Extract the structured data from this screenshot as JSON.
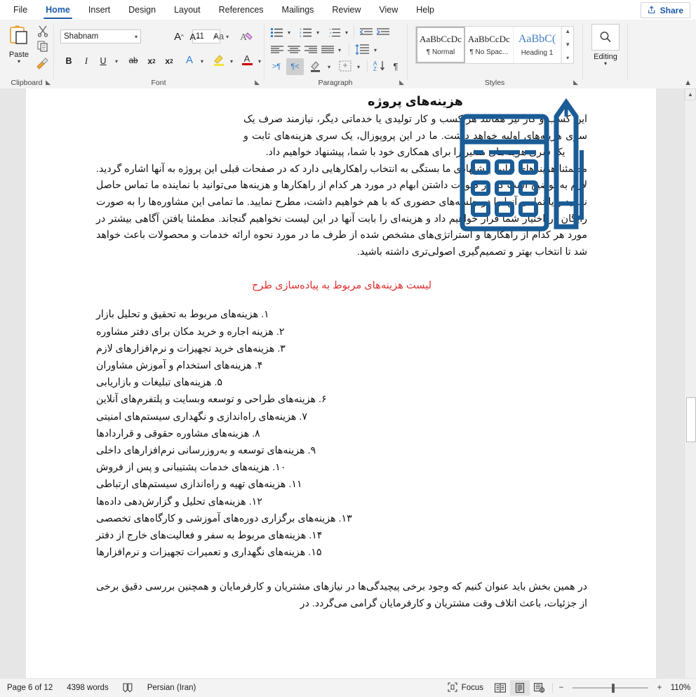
{
  "titlebar": {
    "share_label": "Share"
  },
  "tabs": [
    {
      "label": "File",
      "active": false
    },
    {
      "label": "Home",
      "active": true
    },
    {
      "label": "Insert",
      "active": false
    },
    {
      "label": "Design",
      "active": false
    },
    {
      "label": "Layout",
      "active": false
    },
    {
      "label": "References",
      "active": false
    },
    {
      "label": "Mailings",
      "active": false
    },
    {
      "label": "Review",
      "active": false
    },
    {
      "label": "View",
      "active": false
    },
    {
      "label": "Help",
      "active": false
    }
  ],
  "ribbon": {
    "clipboard": {
      "group_label": "Clipboard",
      "paste_label": "Paste",
      "cut_icon": "scissors-icon",
      "copy_icon": "copy-icon",
      "format_painter_icon": "paintbrush-icon",
      "dialog_launcher": "⤵"
    },
    "font": {
      "group_label": "Font",
      "font_name": "Shabnam",
      "font_size": "11",
      "grow_font": "A",
      "shrink_font": "A",
      "change_case": "Aa",
      "clear_formatting": "A",
      "bold": "B",
      "italic": "I",
      "underline": "U",
      "strikethrough": "ab",
      "subscript": "x",
      "superscript": "x",
      "text_effects": "A",
      "highlight": "A",
      "font_color": "A",
      "dialog_launcher": "⤵"
    },
    "paragraph": {
      "group_label": "Paragraph",
      "bullets": "bullets-icon",
      "numbering": "numbering-icon",
      "multilevel": "multilevel-list-icon",
      "decrease_indent": "decrease-indent-icon",
      "increase_indent": "increase-indent-icon",
      "align_left": "align-left-icon",
      "center": "align-center-icon",
      "align_right": "align-right-icon",
      "justify": "justify-icon",
      "line_spacing": "line-spacing-icon",
      "ltr": ">¶",
      "rtl": "¶<",
      "shading": "shading-icon",
      "borders": "borders-icon",
      "sort": "sort-icon",
      "show_marks": "¶",
      "dialog_launcher": "⤵"
    },
    "styles": {
      "group_label": "Styles",
      "items": [
        {
          "sample": "AaBbCcDc",
          "name": "¶ Normal",
          "selected": true
        },
        {
          "sample": "AaBbCcDc",
          "name": "¶ No Spac...",
          "selected": false
        },
        {
          "sample": "AaBbC(",
          "name": "Heading 1",
          "selected": false
        }
      ],
      "dialog_launcher": "⤵"
    },
    "editing": {
      "group_label": "",
      "label": "Editing",
      "icon": "magnifier-icon"
    },
    "collapse_icon": "chevron-up-icon"
  },
  "document": {
    "heading": "هزینه‌های پروژه",
    "paragraph1": "این کسب و کار نیز همانند هر کسب و کار تولیدی یا خدماتی دیگر، نیازمند صرف یک سری هزینه‌های اولیه خواهد داشت. ما در این پروپوزال، یک سری هزینه‌های ثابت و یک سری هزینه‌های متغیر را برای همکاری خود با شما، پیشنهاد خواهیم داد.",
    "paragraph2": "مطمئنا هزینه‌های نهایی پیشنهادی ما بستگی به انتخاب راهکارهایی دارد که در صفحات قبلی این پروژه به آنها اشاره گردید. لازم به توضیح است که در صورت داشتن ابهام در مورد هر کدام از راهکارها و هزینه‌ها می‌توانید با نماینده ما تماس حاصل نمایید و یا تمامی آنها را در جلسه‌های حضوری که با هم خواهیم داشت، مطرح نمایید. ما تمامی این مشاوره‌ها را به صورت رایگان در اختیار شما قرار خواهیم داد و هزینه‌ای را بابت آنها در این لیست نخواهیم گنجاند. مطمئنا یافتن آگاهی بیشتر در مورد هر کدام از راهکارها و استراتژی‌های مشخص شده از طرف ما در مورد نحوه ارائه خدمات و محصولات باعث خواهد شد تا انتخاب بهتر و تصمیم‌گیری اصولی‌تری داشته باشید.",
    "red_heading": "لیست هزینه‌های مربوط به پیاده‌سازی طرح",
    "red_heading_color": "#e03030",
    "list": [
      {
        "num": "۱.",
        "text": "هزینه‌های مربوط به تحقیق و تحلیل بازار"
      },
      {
        "num": "۲.",
        "text": "هزینه اجاره و خرید مکان برای دفتر مشاوره"
      },
      {
        "num": "۳.",
        "text": "هزینه‌های خرید تجهیزات و نرم‌افزارهای لازم"
      },
      {
        "num": "۴.",
        "text": "هزینه‌های استخدام و آموزش مشاوران"
      },
      {
        "num": "۵.",
        "text": "هزینه‌های تبلیغات و بازاریابی"
      },
      {
        "num": "۶.",
        "text": "هزینه‌های طراحی و توسعه وبسایت و پلتفرم‌های آنلاین"
      },
      {
        "num": "۷.",
        "text": "هزینه‌های راه‌اندازی و نگهداری سیستم‌های امنیتی"
      },
      {
        "num": "۸.",
        "text": "هزینه‌های مشاوره حقوقی و قراردادها"
      },
      {
        "num": "۹.",
        "text": "هزینه‌های توسعه و به‌روزرسانی نرم‌افزارهای داخلی"
      },
      {
        "num": "۱۰.",
        "text": "هزینه‌های خدمات پشتیبانی و پس از فروش"
      },
      {
        "num": "۱۱.",
        "text": "هزینه‌های تهیه و راه‌اندازی سیستم‌های ارتباطی"
      },
      {
        "num": "۱۲.",
        "text": "هزینه‌های تحلیل و گزارش‌دهی داده‌ها"
      },
      {
        "num": "۱۳.",
        "text": "هزینه‌های برگزاری دوره‌های آموزشی و کارگاه‌های تخصصی"
      },
      {
        "num": "۱۴.",
        "text": "هزینه‌های مربوط به سفر و فعالیت‌های خارج از دفتر"
      },
      {
        "num": "۱۵.",
        "text": "هزینه‌های نگهداری و تعمیرات تجهیزات و نرم‌افزارها"
      }
    ],
    "paragraph3": "در همین بخش باید عنوان کنیم که وجود برخی پیچیدگی‌ها در نیازهای مشتریان و کارفرمایان و همچنین بررسی دقیق برخی از جزئیات، باعث اتلاف وقت مشتریان و کارفرمایان گرامی می‌گردد. در",
    "illustration": "calculator-and-pencil-icon",
    "illustration_color": "#1a5c96"
  },
  "statusbar": {
    "page": "Page 6 of 12",
    "words": "4398 words",
    "proofing_icon": "proofing-errors-icon",
    "language": "Persian (Iran)",
    "focus_label": "Focus",
    "focus_icon": "focus-icon",
    "view_read": "read-mode-icon",
    "view_print": "print-layout-icon",
    "view_web": "web-layout-icon",
    "zoom_out": "−",
    "zoom_in": "+",
    "zoom_level": "110%"
  }
}
